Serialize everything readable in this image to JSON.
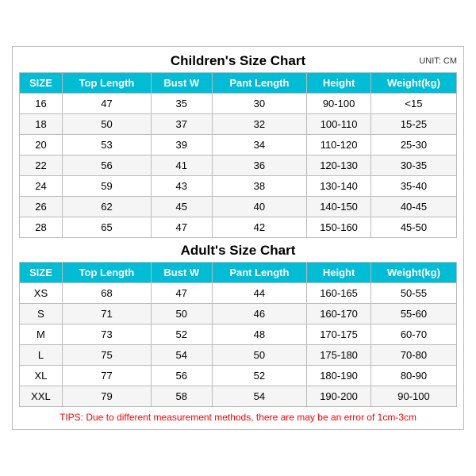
{
  "children_title": "Children's Size Chart",
  "adult_title": "Adult's Size Chart",
  "unit_label": "UNIT: CM",
  "children_headers": [
    "SIZE",
    "Top Length",
    "Bust W",
    "Pant Length",
    "Height",
    "Weight(kg)"
  ],
  "children_rows": [
    [
      "16",
      "47",
      "35",
      "30",
      "90-100",
      "<15"
    ],
    [
      "18",
      "50",
      "37",
      "32",
      "100-110",
      "15-25"
    ],
    [
      "20",
      "53",
      "39",
      "34",
      "110-120",
      "25-30"
    ],
    [
      "22",
      "56",
      "41",
      "36",
      "120-130",
      "30-35"
    ],
    [
      "24",
      "59",
      "43",
      "38",
      "130-140",
      "35-40"
    ],
    [
      "26",
      "62",
      "45",
      "40",
      "140-150",
      "40-45"
    ],
    [
      "28",
      "65",
      "47",
      "42",
      "150-160",
      "45-50"
    ]
  ],
  "adult_headers": [
    "SIZE",
    "Top Length",
    "Bust W",
    "Pant Length",
    "Height",
    "Weight(kg)"
  ],
  "adult_rows": [
    [
      "XS",
      "68",
      "47",
      "44",
      "160-165",
      "50-55"
    ],
    [
      "S",
      "71",
      "50",
      "46",
      "160-170",
      "55-60"
    ],
    [
      "M",
      "73",
      "52",
      "48",
      "170-175",
      "60-70"
    ],
    [
      "L",
      "75",
      "54",
      "50",
      "175-180",
      "70-80"
    ],
    [
      "XL",
      "77",
      "56",
      "52",
      "180-190",
      "80-90"
    ],
    [
      "XXL",
      "79",
      "58",
      "54",
      "190-200",
      "90-100"
    ]
  ],
  "tips": "TIPS: Due to different measurement methods, there are may be an error of 1cm-3cm"
}
